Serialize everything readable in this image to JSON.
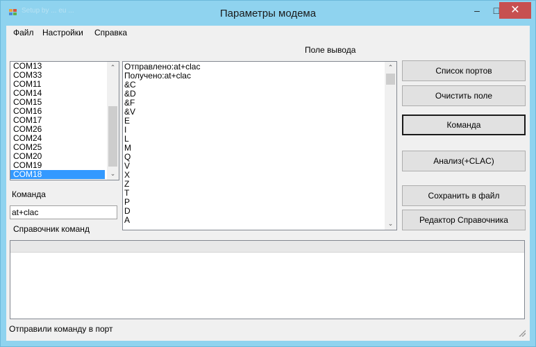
{
  "window": {
    "title": "Параметры модема",
    "watermark": "Setup by ... eu ...",
    "buttons": {
      "minimize": "–",
      "maximize": "□",
      "close": "✕"
    }
  },
  "menu": [
    "Файл",
    "Настройки",
    "Справка"
  ],
  "output_label": "Поле вывода",
  "ports": {
    "items": [
      "COM13",
      "COM33",
      "COM11",
      "COM14",
      "COM15",
      "COM16",
      "COM17",
      "COM26",
      "COM24",
      "COM25",
      "COM20",
      "COM19",
      "COM18"
    ],
    "selected": "COM18"
  },
  "command": {
    "label": "Команда",
    "value": "at+clac"
  },
  "reference_label": "Справочник команд",
  "output_lines": [
    "Отправлено:at+clac",
    "Получено:at+clac",
    "&C",
    "&D",
    "&F",
    "&V",
    "E",
    "I",
    "L",
    "M",
    "Q",
    "V",
    "X",
    "Z",
    "T",
    "P",
    "D",
    "A"
  ],
  "buttons": {
    "port_list": "Список портов",
    "clear": "Очистить поле",
    "command": "Команда",
    "analyze": "Анализ(+CLAC)",
    "save": "Сохранить в файл",
    "editor": "Редактор Справочника"
  },
  "status": "Отправили команду в порт",
  "icons": {
    "scroll_up": "chevron-up-icon",
    "scroll_down": "chevron-down-icon",
    "app": "app-icon"
  },
  "colors": {
    "titlebar": "#8fd3ef",
    "selection": "#3399ff",
    "close": "#c75050"
  }
}
